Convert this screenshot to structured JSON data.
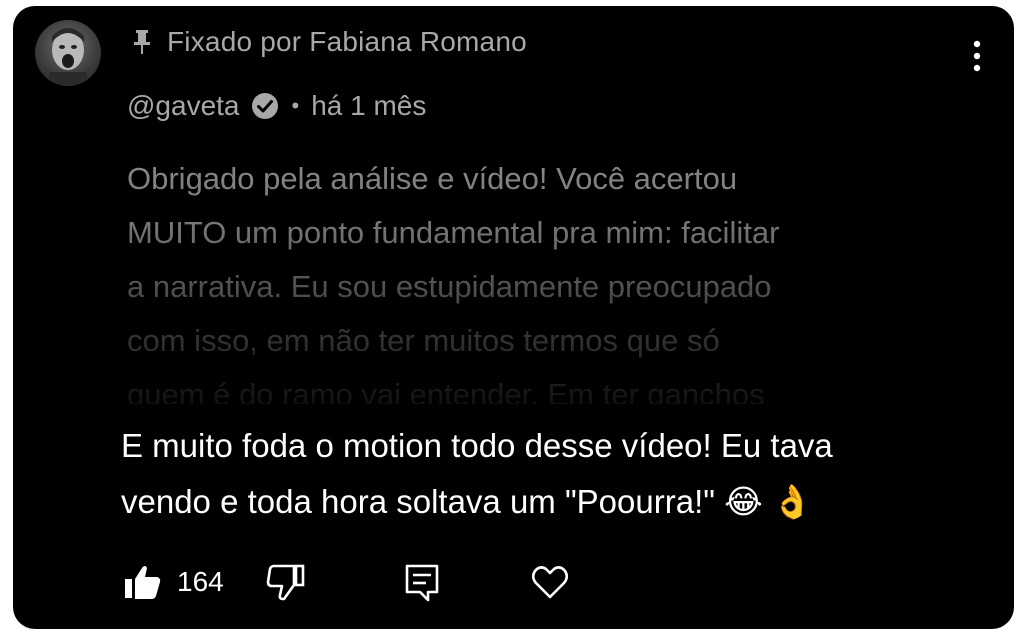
{
  "pinned": {
    "label": "Fixado por Fabiana Romano",
    "icon": "pin-icon"
  },
  "author": {
    "handle": "@gaveta",
    "verified": true,
    "separator": "•",
    "time": "há 1 mês"
  },
  "comment": {
    "lines": [
      "Obrigado pela análise e vídeo! Você acertou",
      "MUITO um ponto fundamental pra mim: facilitar",
      "a narrativa. Eu sou estupidamente preocupado",
      "com isso, em não ter muitos termos  que só",
      "quem é do ramo vai entender. Em ter ganchos"
    ]
  },
  "caption": {
    "line1": "E muito foda o motion todo desse vídeo! Eu tava",
    "line2": "vendo e toda hora soltava um \"Poourra!\"",
    "emoji1": "😂",
    "emoji2": "👌"
  },
  "actions": {
    "like_count": "164"
  },
  "colors": {
    "background": "#000000",
    "muted_text": "#a8a8a8",
    "primary_text": "#ffffff"
  }
}
